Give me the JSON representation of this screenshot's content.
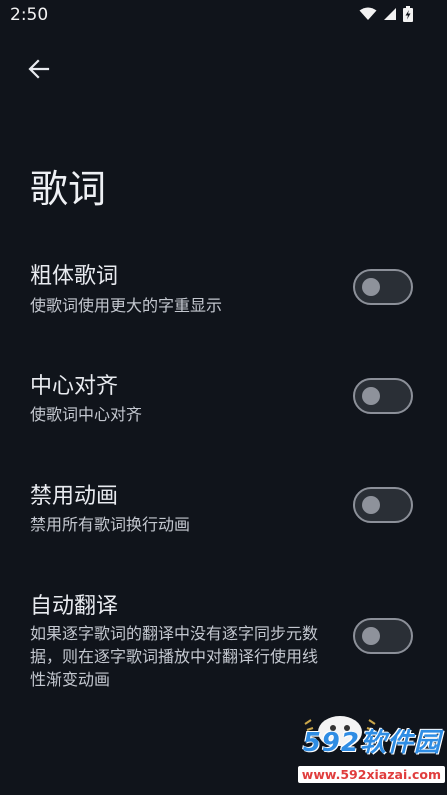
{
  "status_bar": {
    "time": "2:50",
    "icons": [
      "wifi-icon",
      "signal-icon",
      "battery-charging-icon"
    ]
  },
  "header": {
    "back_icon": "arrow-left-icon",
    "title": "歌词"
  },
  "settings": [
    {
      "title": "粗体歌词",
      "description": "使歌词使用更大的字重显示",
      "enabled": false
    },
    {
      "title": "中心对齐",
      "description": "使歌词中心对齐",
      "enabled": false
    },
    {
      "title": "禁用动画",
      "description": "禁用所有歌词换行动画",
      "enabled": false
    },
    {
      "title": "自动翻译",
      "description": "如果逐字歌词的翻译中没有逐字同步元数据，则在逐字歌词播放中对翻译行使用线性渐变动画",
      "enabled": false
    }
  ],
  "watermark": {
    "brand": "592软件园",
    "url": "www.592xiazai.com"
  },
  "colors": {
    "background": "#10141b",
    "toggle_outline": "#8c9099",
    "toggle_thumb": "#8e929b",
    "watermark_blue": "#2f8de4",
    "watermark_red": "#e03d3d"
  }
}
